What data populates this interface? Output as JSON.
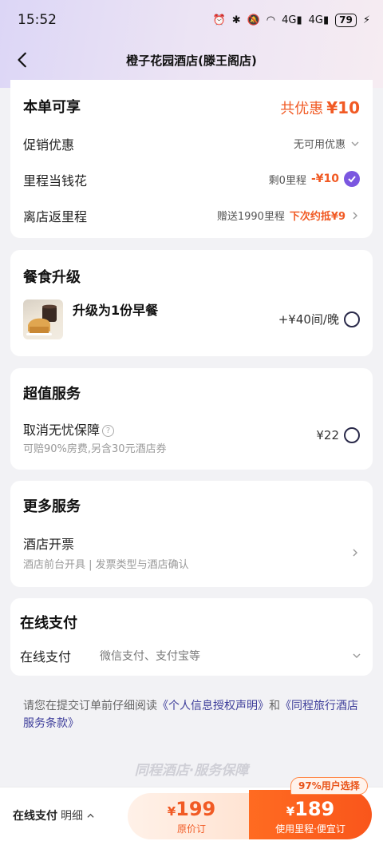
{
  "status_bar": {
    "time": "15:52",
    "network_1": "4G",
    "network_2": "4G",
    "battery": "79"
  },
  "header": {
    "title": "橙子花园酒店(滕王阁店)"
  },
  "offers": {
    "title": "本单可享",
    "total_label": "共优惠",
    "total_amount": "¥10",
    "promo_label": "促销优惠",
    "promo_value": "无可用优惠",
    "mileage_label": "里程当钱花",
    "mileage_remaining": "剩0里程",
    "mileage_discount": "-¥10",
    "return_label": "离店返里程",
    "return_value": "赠送1990里程",
    "return_next": "下次约抵¥9"
  },
  "meal": {
    "title": "餐食升级",
    "item_label": "升级为1份早餐",
    "item_price": "+¥40间/晚"
  },
  "service": {
    "title": "超值服务",
    "item_label": "取消无忧保障",
    "item_desc": "可赔90%房费,另含30元酒店券",
    "item_price": "¥22"
  },
  "more": {
    "title": "更多服务",
    "invoice_label": "酒店开票",
    "invoice_desc": "酒店前台开具 | 发票类型与酒店确认"
  },
  "payment": {
    "title": "在线支付",
    "method_label": "在线支付",
    "method_value": "微信支付、支付宝等"
  },
  "notice": {
    "prefix": "请您在提交订单前仔细阅读",
    "link1": "《个人信息授权声明》",
    "and": "和",
    "link2": "《同程旅行酒店服务条款》"
  },
  "guarantee": "同程酒店·服务保障",
  "bottom": {
    "pay_mode": "在线支付",
    "detail": "明细",
    "original_price": "199",
    "original_caption": "原价订",
    "mileage_price": "189",
    "mileage_caption": "使用里程·便宜订",
    "badge": "97%用户选择",
    "currency": "¥"
  }
}
